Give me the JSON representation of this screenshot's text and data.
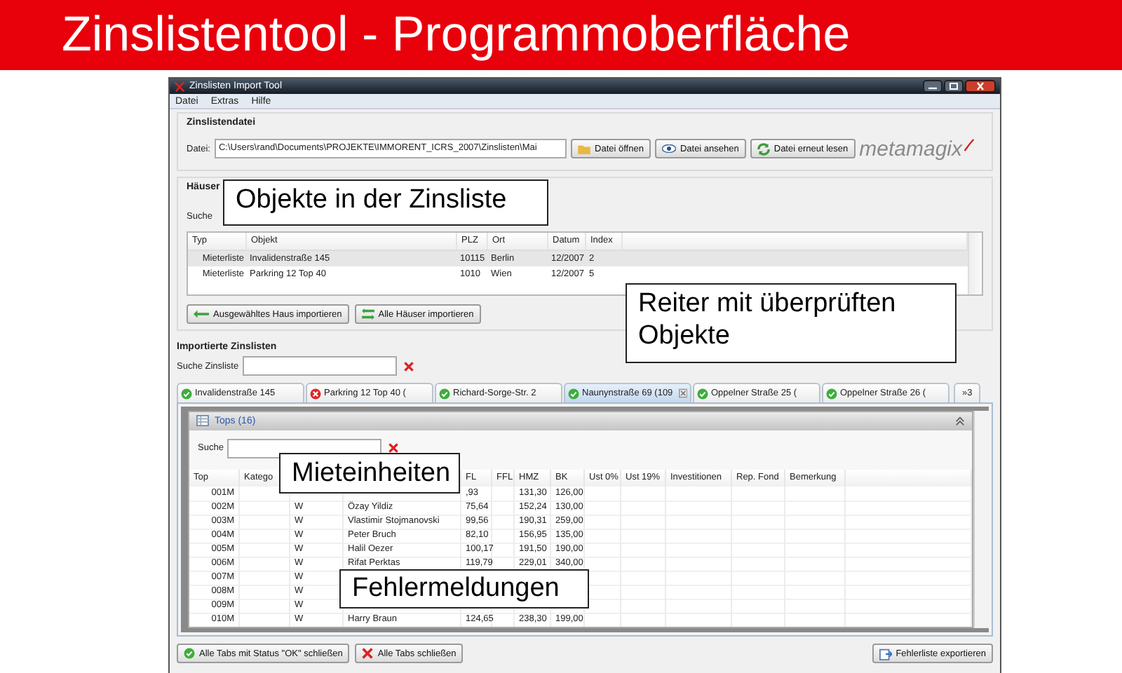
{
  "slide_title": "Zinslistentool - Programmoberfläche",
  "window": {
    "title": "Zinslisten Import Tool"
  },
  "menu": [
    "Datei",
    "Extras",
    "Hilfe"
  ],
  "file_group": {
    "title": "Zinslistendatei",
    "label": "Datei:",
    "path": "C:\\Users\\rand\\Documents\\PROJEKTE\\IMMORENT_ICRS_2007\\Zinslisten\\Mai",
    "buttons": [
      "Datei öffnen",
      "Datei ansehen",
      "Datei erneut lesen"
    ],
    "logo": "metamagix"
  },
  "houses": {
    "title": "Häuser",
    "search_label": "Suche",
    "columns": [
      "Typ",
      "Objekt",
      "PLZ",
      "Ort",
      "Datum",
      "Index"
    ],
    "rows": [
      {
        "cells": [
          "Mieterliste",
          "Invalidenstraße 145",
          "10115",
          "Berlin",
          "12/2007",
          "2"
        ],
        "selected": true
      },
      {
        "cells": [
          "Mieterliste",
          "Parkring 12 Top 40",
          "1010",
          "Wien",
          "12/2007",
          "5"
        ],
        "selected": false
      }
    ],
    "buttons": [
      "Ausgewähltes Haus importieren",
      "Alle Häuser importieren"
    ]
  },
  "imported": {
    "title": "Importierte Zinslisten",
    "search_label": "Suche Zinsliste",
    "tabs": [
      {
        "label": "Invalidenstraße 145",
        "kind": "ok",
        "selected": false
      },
      {
        "label": "Parkring 12 Top 40 (",
        "kind": "error",
        "selected": false
      },
      {
        "label": "Richard-Sorge-Str. 2",
        "kind": "ok",
        "selected": false
      },
      {
        "label": "Naunynstraße 69 (109",
        "kind": "ok",
        "selected": true
      },
      {
        "label": "Oppelner Straße 25 (",
        "kind": "ok",
        "selected": false
      },
      {
        "label": "Oppelner Straße 26 (",
        "kind": "ok",
        "selected": false
      }
    ],
    "overflow": "»3",
    "panel": {
      "title": "Tops (16)",
      "search_label": "Suche",
      "columns": [
        "Top",
        "Katego",
        null,
        null,
        "FL",
        "FFL",
        "HMZ",
        "BK",
        "Ust 0%",
        "Ust 19%",
        "Investitionen",
        "Rep. Fond",
        "Bemerkung"
      ],
      "rows": [
        [
          "001M",
          null,
          null,
          null,
          ",93",
          null,
          "131,30",
          "126,00"
        ],
        [
          "002M",
          null,
          "W",
          "Özay Yildiz",
          "75,64",
          null,
          "152,24",
          "130,00"
        ],
        [
          "003M",
          null,
          "W",
          "Vlastimir Stojmanovski",
          "99,56",
          null,
          "190,31",
          "259,00"
        ],
        [
          "004M",
          null,
          "W",
          "Peter Bruch",
          "82,10",
          null,
          "156,95",
          "135,00"
        ],
        [
          "005M",
          null,
          "W",
          "Halil Oezer",
          "100,17",
          null,
          "191,50",
          "190,00"
        ],
        [
          "006M",
          null,
          "W",
          "Rifat Perktas",
          "119,79",
          null,
          "229,01",
          "340,00"
        ],
        [
          "007M",
          null,
          "W"
        ],
        [
          "008M",
          null,
          "W"
        ],
        [
          "009M",
          null,
          "W"
        ],
        [
          "010M",
          null,
          "W",
          "Harry Braun",
          "124,65",
          null,
          "238,30",
          "199,00"
        ]
      ]
    }
  },
  "footer_buttons": [
    "Alle Tabs mit Status \"OK\" schließen",
    "Alle Tabs schließen",
    "Fehlerliste exportieren"
  ],
  "callouts": [
    "Objekte  in der Zinsliste",
    "Reiter mit überprüften Objekte",
    "Mieteinheiten",
    "Fehlermeldungen"
  ]
}
